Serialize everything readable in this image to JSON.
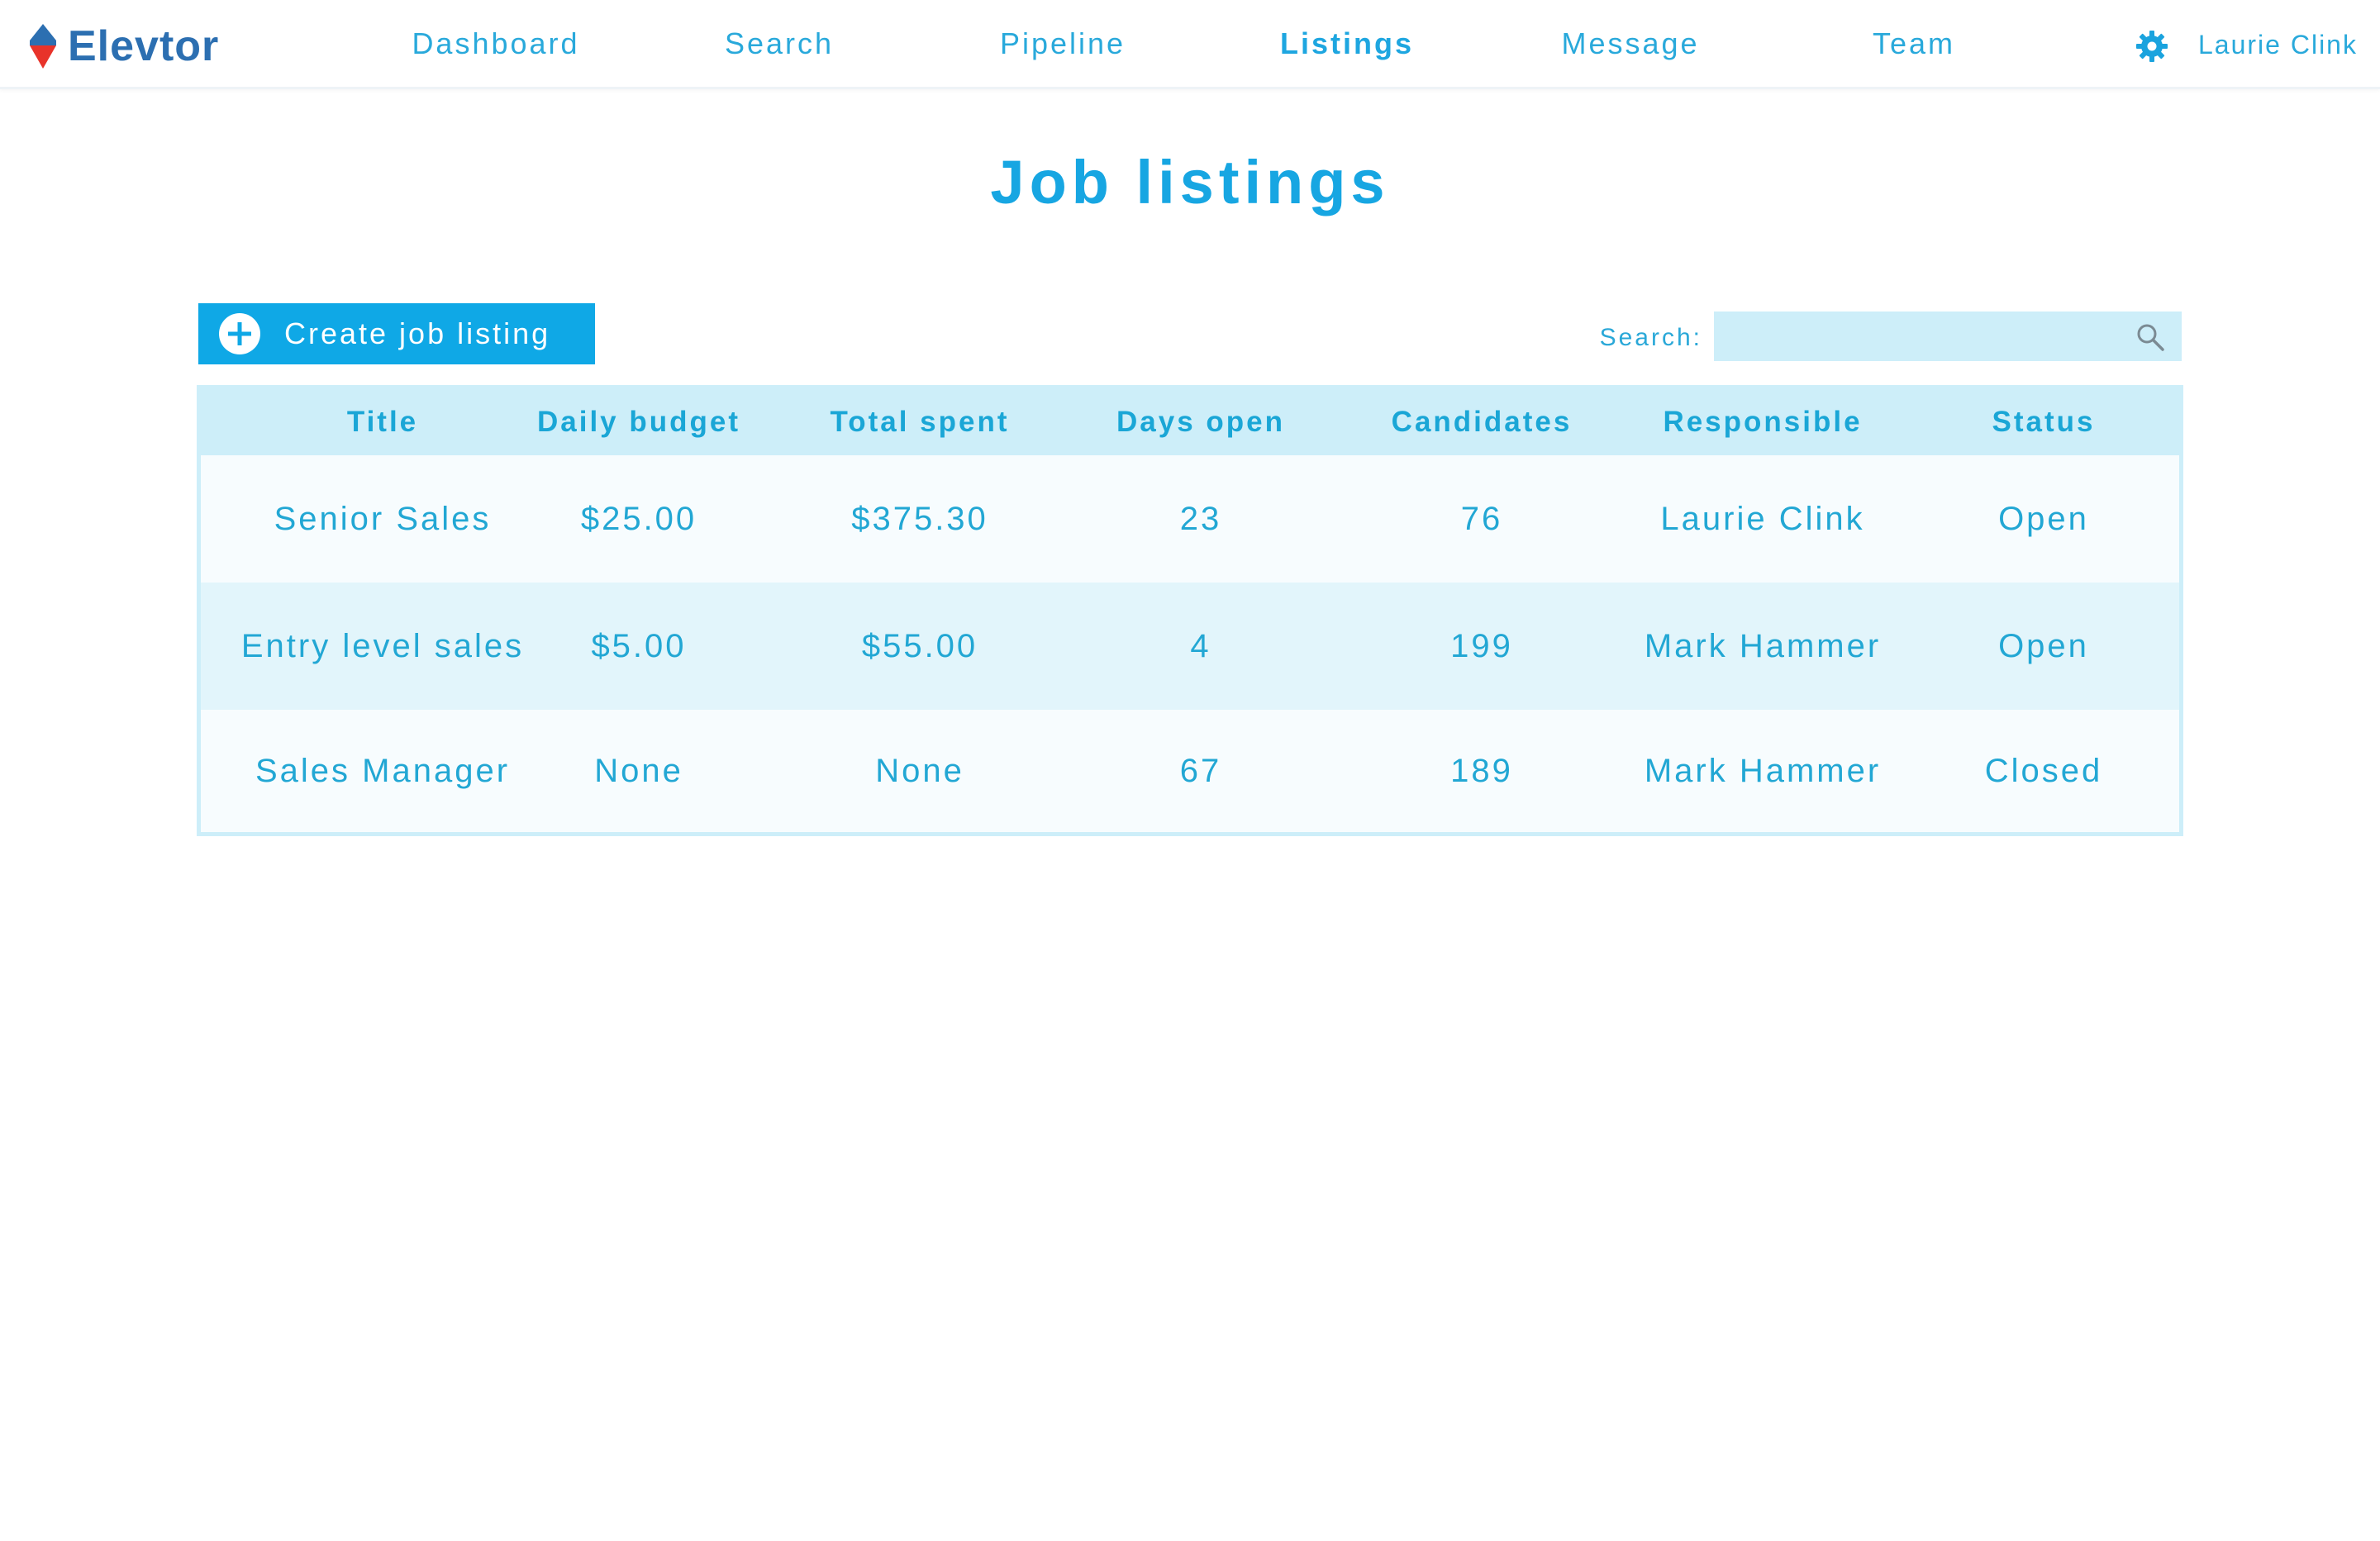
{
  "app": {
    "name": "Elevtor"
  },
  "nav": {
    "items": [
      {
        "label": "Dashboard"
      },
      {
        "label": "Search"
      },
      {
        "label": "Pipeline"
      },
      {
        "label": "Listings",
        "active": true
      },
      {
        "label": "Message"
      },
      {
        "label": "Team"
      }
    ],
    "user": "Laurie Clink"
  },
  "page": {
    "title": "Job listings"
  },
  "toolbar": {
    "create_label": "Create job listing",
    "search_label": "Search:",
    "search_value": "",
    "search_placeholder": ""
  },
  "table": {
    "headers": [
      "Title",
      "Daily budget",
      "Total spent",
      "Days open",
      "Candidates",
      "Responsible",
      "Status"
    ],
    "rows": [
      [
        "Senior Sales",
        "$25.00",
        "$375.30",
        "23",
        "76",
        "Laurie Clink",
        "Open"
      ],
      [
        "Entry level sales",
        "$5.00",
        "$55.00",
        "4",
        "199",
        "Mark Hammer",
        "Open"
      ],
      [
        "Sales Manager",
        "None",
        "None",
        "67",
        "189",
        "Mark Hammer",
        "Closed"
      ]
    ]
  },
  "colors": {
    "accent": "#0fa8e6",
    "logo_blue": "#2c6fb1",
    "logo_red": "#e8332a",
    "header_bg": "#cdeef9",
    "row_alt_bg": "#e2f5fb"
  }
}
